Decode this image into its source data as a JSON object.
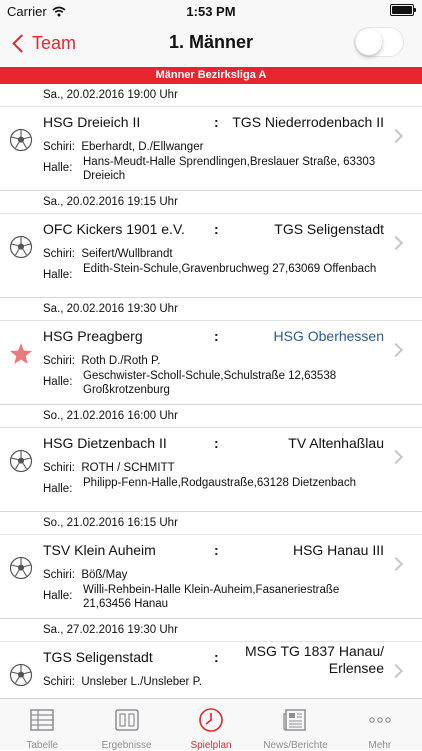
{
  "status_bar": {
    "carrier": "Carrier",
    "time": "1:53 PM"
  },
  "nav": {
    "back_label": "Team",
    "title": "1. Männer"
  },
  "league": "Männer Bezirksliga A",
  "labels": {
    "referee": "Schiri:",
    "hall": "Halle:",
    "separator": ":"
  },
  "matches": [
    {
      "date": "Sa., 20.02.2016 19:00 Uhr",
      "home": "HSG Dreieich II",
      "away": "TGS Niederrodenbach II",
      "referee": "Eberhardt, D./Ellwanger",
      "hall": "Hans-Meudt-Halle Sprendlingen,Breslauer Straße, 63303  Dreieich",
      "icon": "handball-icon"
    },
    {
      "date": "Sa., 20.02.2016 19:15 Uhr",
      "home": "OFC Kickers 1901 e.V.",
      "away": "TGS Seligenstadt",
      "referee": "Seifert/Wullbrandt",
      "hall": "Edith-Stein-Schule,Gravenbruchweg 27,63069 Offenbach",
      "icon": "handball-icon"
    },
    {
      "date": "Sa., 20.02.2016 19:30 Uhr",
      "home": "HSG Preagberg",
      "away": "HSG Oberhessen",
      "referee": "Roth D./Roth P.",
      "hall": "Geschwister-Scholl-Schule,Schulstraße 12,63538 Großkrotzenburg",
      "icon": "star-icon"
    },
    {
      "date": "So., 21.02.2016 16:00 Uhr",
      "home": "HSG Dietzenbach II",
      "away": "TV Altenhaßlau",
      "referee": "ROTH / SCHMITT",
      "hall": "Philipp-Fenn-Halle,Rodgaustraße,63128  Dietzenbach",
      "icon": "handball-icon"
    },
    {
      "date": "So., 21.02.2016 16:15 Uhr",
      "home": "TSV Klein Auheim",
      "away": "HSG Hanau III",
      "referee": "Böß/May",
      "hall": "Willi-Rehbein-Halle Klein-Auheim,Fasaneriestraße 21,63456  Hanau",
      "icon": "handball-icon"
    },
    {
      "date": "Sa., 27.02.2016 19:30 Uhr",
      "home": "TGS Seligenstadt",
      "away": "MSG TG 1837 Hanau/ Erlensee",
      "referee": "Unsleber L./Unsleber P.",
      "hall": "",
      "icon": "handball-icon"
    }
  ],
  "tabs": [
    {
      "label": "Tabelle",
      "icon": "table-icon"
    },
    {
      "label": "Ergebnisse",
      "icon": "scoreboard-icon"
    },
    {
      "label": "Spielplan",
      "icon": "clock-icon",
      "active": true
    },
    {
      "label": "News/Berichte",
      "icon": "newspaper-icon"
    },
    {
      "label": "Mehr",
      "icon": "more-icon"
    }
  ],
  "colors": {
    "accent": "#e5262d",
    "link": "#2f5b8e"
  }
}
